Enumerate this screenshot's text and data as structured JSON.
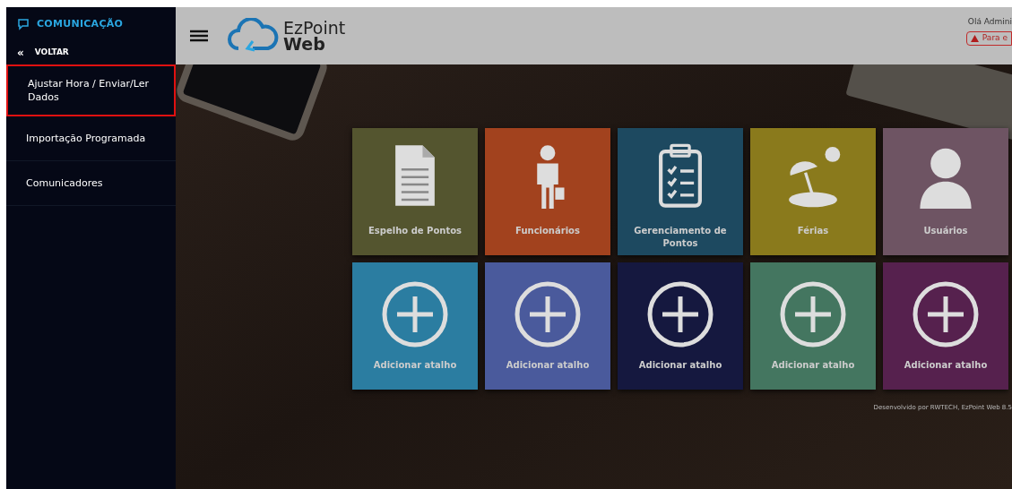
{
  "sidebar": {
    "section_title": "COMUNICAÇÃO",
    "back_icon": "«",
    "back_label": "VOLTAR",
    "items": [
      {
        "label": "Ajustar Hora / Enviar/Ler Dados",
        "selected": true
      },
      {
        "label": "Importação Programada",
        "selected": false
      },
      {
        "label": "Comunicadores",
        "selected": false
      }
    ]
  },
  "header": {
    "logo_top": "EzPoint",
    "logo_bottom": "Web",
    "greeting": "Olá Admini",
    "alert": "Para e"
  },
  "tiles": [
    {
      "label": "Espelho de Pontos",
      "kind": "document",
      "color": "#54552f"
    },
    {
      "label": "Funcionários",
      "kind": "person",
      "color": "#a2421e"
    },
    {
      "label": "Gerenciamento de Pontos",
      "kind": "clipboard",
      "color": "#1d4960"
    },
    {
      "label": "Férias",
      "kind": "beach",
      "color": "#8a7a1c"
    },
    {
      "label": "Usuários",
      "kind": "user",
      "color": "#6e5463"
    },
    {
      "label": "Adicionar atalho",
      "kind": "add",
      "color": "#2b7da1"
    },
    {
      "label": "Adicionar atalho",
      "kind": "add",
      "color": "#4a5a9c"
    },
    {
      "label": "Adicionar atalho",
      "kind": "add",
      "color": "#15183f"
    },
    {
      "label": "Adicionar atalho",
      "kind": "add",
      "color": "#447660"
    },
    {
      "label": "Adicionar atalho",
      "kind": "add",
      "color": "#56214e"
    }
  ],
  "footer": "Desenvolvido por RWTECH, EzPoint Web 8.5"
}
